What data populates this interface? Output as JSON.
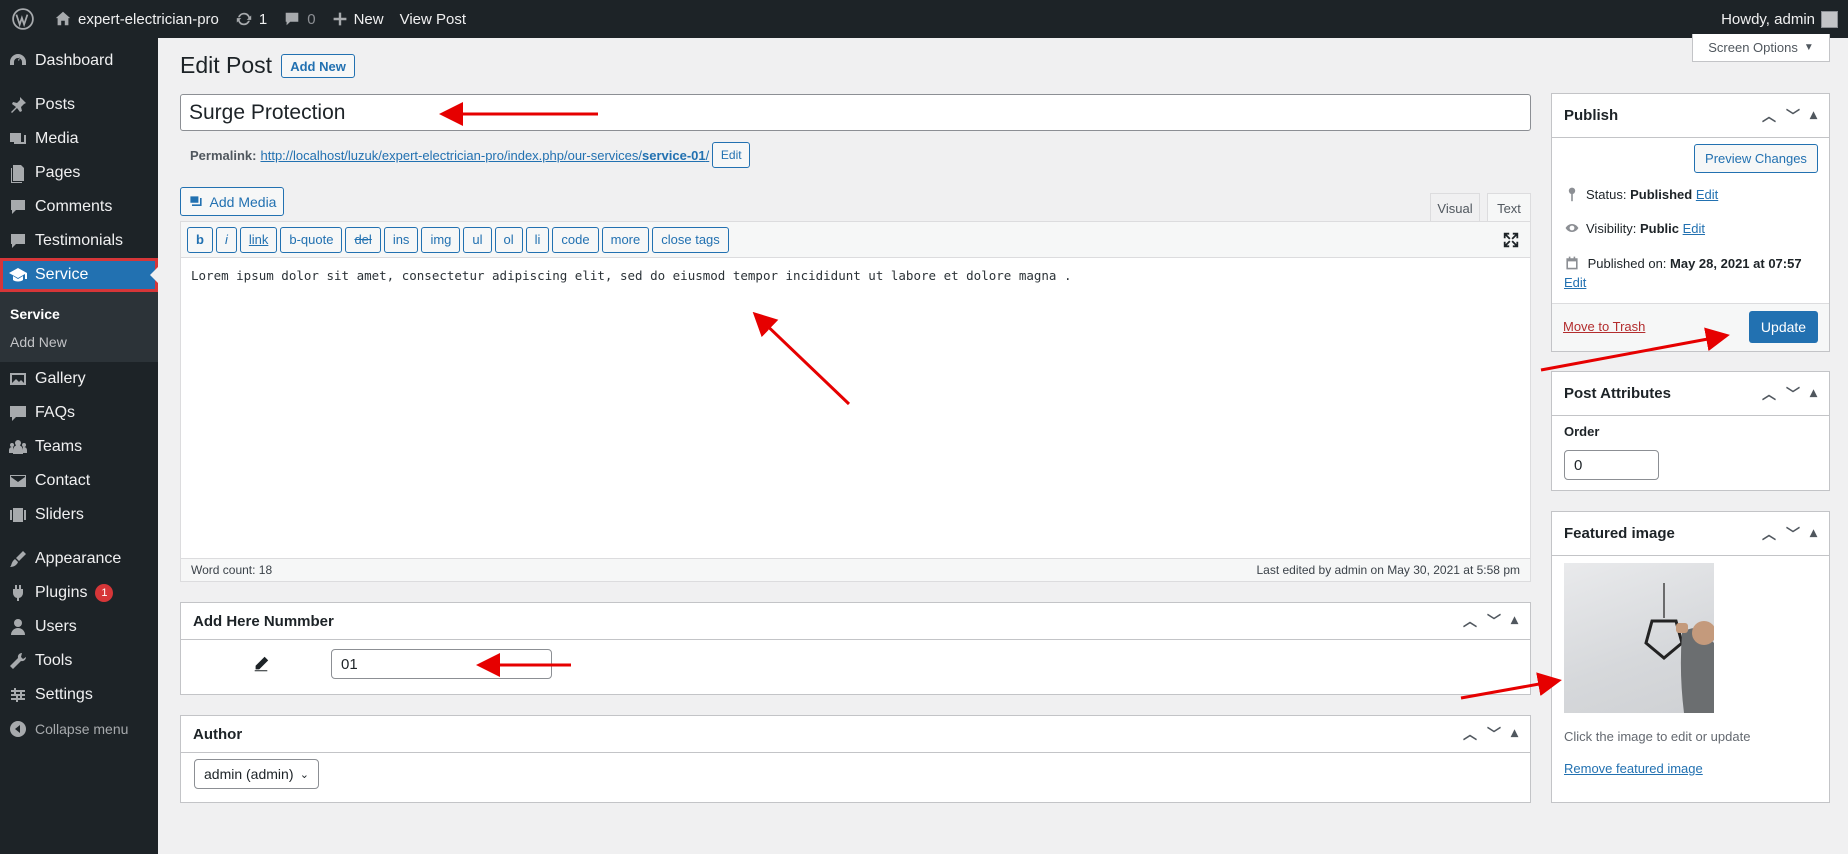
{
  "adminbar": {
    "site_name": "expert-electrician-pro",
    "updates_count": "1",
    "comments_count": "0",
    "new_label": "New",
    "view_post_label": "View Post",
    "howdy": "Howdy, admin"
  },
  "sidebar": {
    "dashboard": "Dashboard",
    "posts": "Posts",
    "media": "Media",
    "pages": "Pages",
    "comments": "Comments",
    "testimonials": "Testimonials",
    "service": "Service",
    "submenu": {
      "current": "Service",
      "add_new": "Add New"
    },
    "gallery": "Gallery",
    "faqs": "FAQs",
    "teams": "Teams",
    "contact": "Contact",
    "sliders": "Sliders",
    "appearance": "Appearance",
    "plugins": "Plugins",
    "plugins_badge": "1",
    "users": "Users",
    "tools": "Tools",
    "settings": "Settings",
    "collapse": "Collapse menu"
  },
  "header": {
    "title": "Edit Post",
    "add_new": "Add New",
    "screen_options": "Screen Options"
  },
  "post": {
    "title": "Surge Protection",
    "permalink_label": "Permalink:",
    "permalink_url": "http://localhost/luzuk/expert-electrician-pro/index.php/our-services/",
    "permalink_slug": "service-01",
    "permalink_trail": "/",
    "permalink_edit": "Edit",
    "add_media": "Add Media",
    "tab_visual": "Visual",
    "tab_text": "Text",
    "quicktags": [
      "b",
      "i",
      "link",
      "b-quote",
      "del",
      "ins",
      "img",
      "ul",
      "ol",
      "li",
      "code",
      "more",
      "close tags"
    ],
    "content": "Lorem ipsum dolor sit amet, consectetur adipiscing elit, sed do eiusmod tempor incididunt ut labore et dolore magna .",
    "word_count": "Word count: 18",
    "last_edited": "Last edited by admin on May 30, 2021 at 5:58 pm"
  },
  "number_box": {
    "title": "Add Here Nummber",
    "value": "01"
  },
  "author_box": {
    "title": "Author",
    "selected": "admin (admin)"
  },
  "publish": {
    "title": "Publish",
    "preview": "Preview Changes",
    "status_label": "Status:",
    "status_value": "Published",
    "status_edit": "Edit",
    "visibility_label": "Visibility:",
    "visibility_value": "Public",
    "visibility_edit": "Edit",
    "published_label": "Published on:",
    "published_value": "May 28, 2021 at 07:57",
    "published_edit": "Edit",
    "trash": "Move to Trash",
    "update": "Update"
  },
  "attributes": {
    "title": "Post Attributes",
    "order_label": "Order",
    "order_value": "0"
  },
  "featured": {
    "title": "Featured image",
    "caption": "Click the image to edit or update",
    "remove": "Remove featured image"
  },
  "colors": {
    "accent": "#2271b1",
    "annotation": "#e60000",
    "sidebar": "#1d2327"
  }
}
